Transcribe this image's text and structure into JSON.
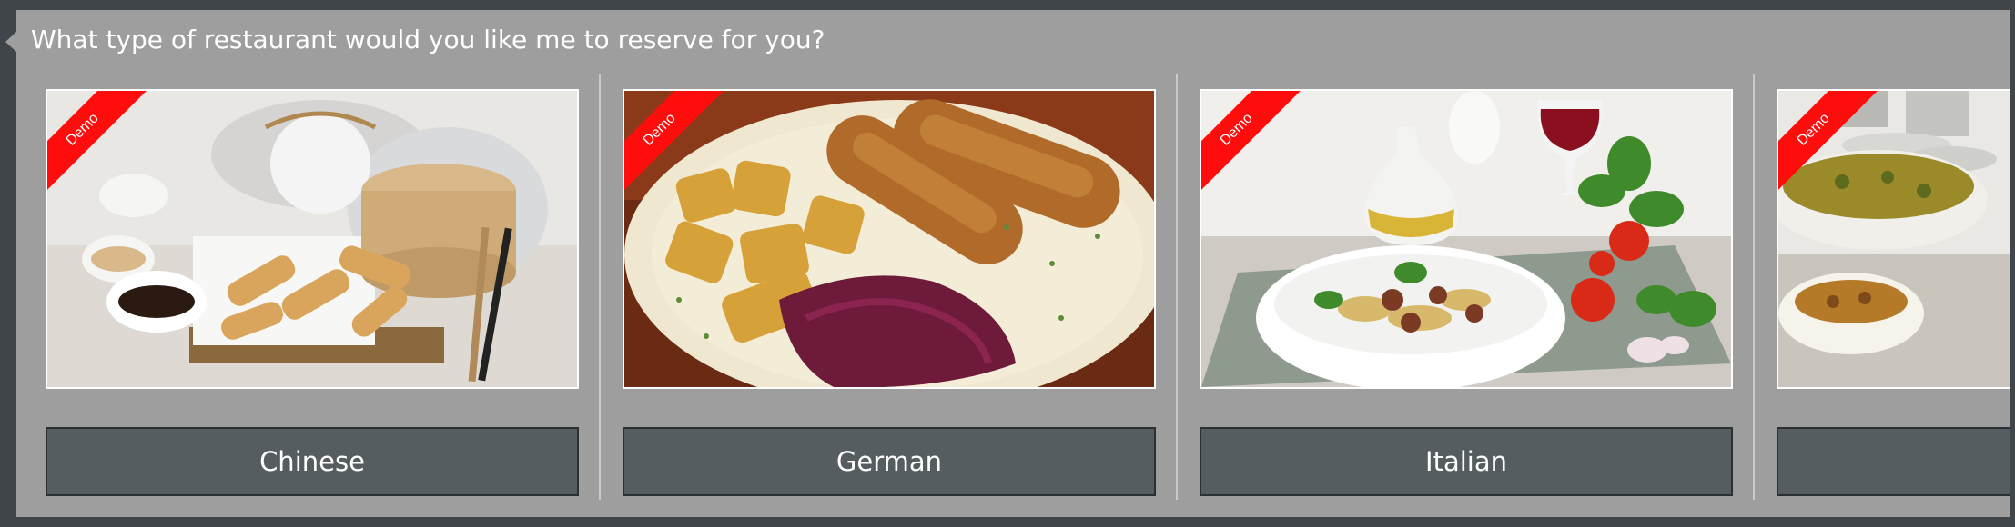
{
  "prompt": {
    "question": "What type of restaurant would you like me to reserve for you?"
  },
  "cards": [
    {
      "label": "Chinese",
      "ribbon": "Demo",
      "image": "dim-sum-teapot-photo"
    },
    {
      "label": "German",
      "ribbon": "Demo",
      "image": "sausages-potatoes-red-cabbage-photo"
    },
    {
      "label": "Italian",
      "ribbon": "Demo",
      "image": "pasta-wine-tomatoes-photo"
    },
    {
      "label": "",
      "ribbon": "Demo",
      "image": "curry-bowl-photo"
    }
  ],
  "colors": {
    "bubble_bg": "#9e9e9e",
    "page_bg": "#3f4549",
    "button_bg": "#565d61",
    "ribbon": "#ff0d0d"
  }
}
